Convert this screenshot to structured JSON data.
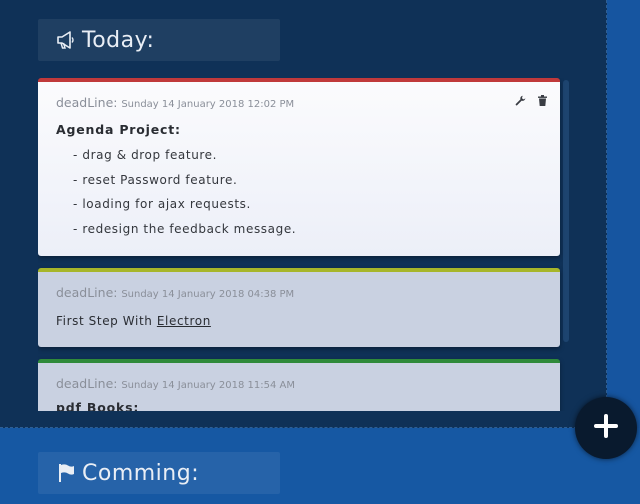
{
  "sections": {
    "today": {
      "title": "Today:",
      "icon": "megaphone-icon"
    },
    "coming": {
      "title": "Comming:",
      "icon": "flag-icon"
    }
  },
  "cards": [
    {
      "accent": "#c0393b",
      "deadline_label": "deadLine:",
      "deadline_value": "Sunday 14 January 2018 12:02 PM",
      "title": "Agenda Project:",
      "items": [
        "drag & drop feature.",
        "reset Password feature.",
        "loading for ajax requests.",
        "redesign the feedback message."
      ],
      "actions": [
        "wrench-icon",
        "trash-icon"
      ]
    },
    {
      "accent": "#a7b62a",
      "deadline_label": "deadLine:",
      "deadline_value": "Sunday 14 January 2018 04:38 PM",
      "text_prefix": "First Step With ",
      "text_link": "Electron"
    },
    {
      "accent": "#2f8a3a",
      "deadline_label": "deadLine:",
      "deadline_value": "Sunday 14 January 2018 11:54 AM",
      "title": "pdf Books:"
    }
  ],
  "fab": {
    "icon": "plus-icon"
  },
  "colors": {
    "top_panel": "#0f3157",
    "bottom_panel": "#1658a3",
    "fab": "#091a2e"
  }
}
